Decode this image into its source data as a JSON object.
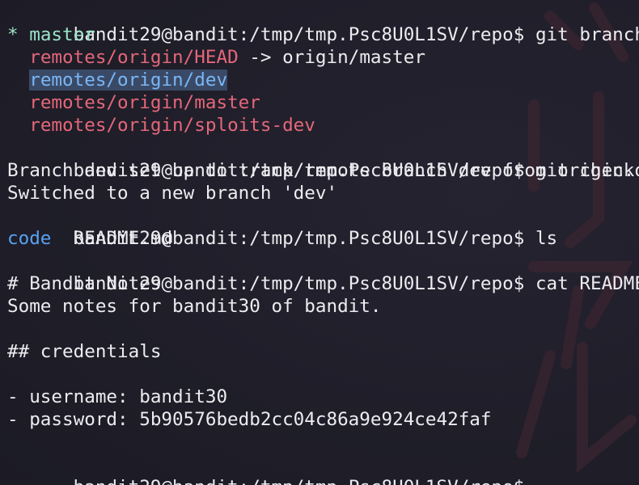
{
  "prompt": "bandit29@bandit:/tmp/tmp.Psc8U0L1SV/repo$",
  "commands": {
    "branch": "git branch -a",
    "checkout": "git checkout dev",
    "ls": "ls",
    "cat": "cat README.md"
  },
  "branches": {
    "current_marker": "*",
    "current": "master",
    "head": "remotes/origin/HEAD",
    "head_arrow": "->",
    "head_target": "origin/master",
    "dev": "remotes/origin/dev",
    "master": "remotes/origin/master",
    "sploits": "remotes/origin/sploits-dev"
  },
  "checkout_output": [
    "Branch dev set up to track remote branch dev from origin.",
    "Switched to a new branch 'dev'"
  ],
  "ls_output": {
    "dir": "code",
    "file": "README.md"
  },
  "readme": {
    "title": "# Bandit Notes",
    "intro": "Some notes for bandit30 of bandit.",
    "section": "## credentials",
    "username": "- username: bandit30",
    "password": "- password: 5b90576bedb2cc04c86a9e924ce42faf"
  },
  "colors": {
    "background": "#1e1e28",
    "text": "#ececf0",
    "current_branch": "#9be3c6",
    "remote_branch": "#e5677a",
    "directory": "#5aa2f2",
    "selection": "#3a4a66"
  }
}
